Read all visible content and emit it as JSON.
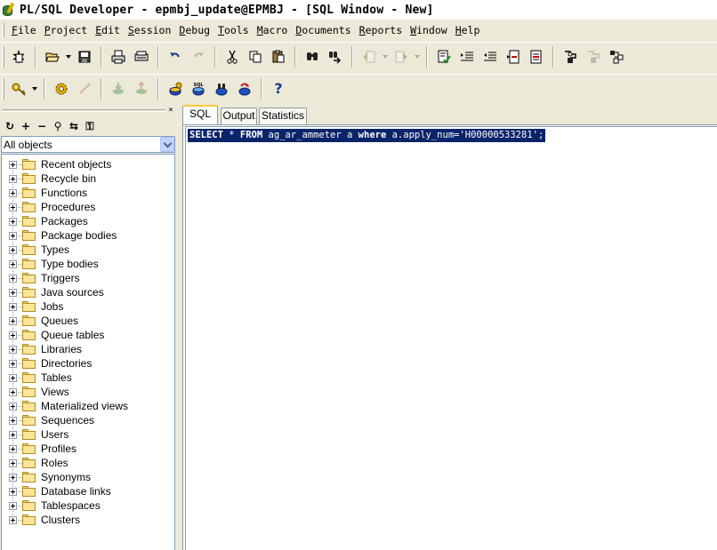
{
  "window": {
    "title": "PL/SQL Developer - epmbj_update@EPMBJ - [SQL Window - New]"
  },
  "menu": [
    {
      "u": "F",
      "rest": "ile"
    },
    {
      "u": "P",
      "rest": "roject"
    },
    {
      "u": "E",
      "rest": "dit"
    },
    {
      "u": "S",
      "rest": "ession"
    },
    {
      "u": "D",
      "rest": "ebug"
    },
    {
      "u": "T",
      "rest": "ools"
    },
    {
      "u": "M",
      "rest": "acro"
    },
    {
      "u": "D",
      "rest": "ocuments"
    },
    {
      "u": "R",
      "rest": "eports"
    },
    {
      "u": "W",
      "rest": "indow"
    },
    {
      "u": "H",
      "rest": "elp"
    }
  ],
  "toolbar1": [
    "new-icon",
    "open-icon",
    "save-icon",
    "print-icon",
    "print-preview-icon",
    "undo-icon",
    "redo-icon",
    "cut-icon",
    "copy-icon",
    "paste-icon",
    "find-icon",
    "find-next-icon",
    "back-icon",
    "forward-icon",
    "compile-icon",
    "indent-icon",
    "unindent-icon",
    "comment-icon",
    "uncomment-icon",
    "execute-icon",
    "break-icon",
    "explain-icon"
  ],
  "toolbar2": [
    "log-on-icon",
    "gear-icon",
    "log-off-icon",
    "commit-icon",
    "rollback-icon",
    "session-sql-icon",
    "sql-window-icon",
    "command-window-icon",
    "refresh-session-icon",
    "help-icon"
  ],
  "object_browser": {
    "close_glyph": "×",
    "tools": [
      "↻",
      "+",
      "−",
      "⚲",
      "⇆",
      "⚿"
    ],
    "filter": "All objects",
    "folders": [
      "Recent objects",
      "Recycle bin",
      "Functions",
      "Procedures",
      "Packages",
      "Package bodies",
      "Types",
      "Type bodies",
      "Triggers",
      "Java sources",
      "Jobs",
      "Queues",
      "Queue tables",
      "Libraries",
      "Directories",
      "Tables",
      "Views",
      "Materialized views",
      "Sequences",
      "Users",
      "Profiles",
      "Roles",
      "Synonyms",
      "Database links",
      "Tablespaces",
      "Clusters"
    ]
  },
  "editor": {
    "tabs": [
      "SQL",
      "Output",
      "Statistics"
    ],
    "active_tab": "SQL",
    "sql": {
      "kw1": "SELECT",
      "t1": " * ",
      "kw2": "FROM",
      "t2": " ag_ar_ammeter a ",
      "kw3": "where",
      "t3": " a.apply_num='H00000533281';"
    }
  }
}
